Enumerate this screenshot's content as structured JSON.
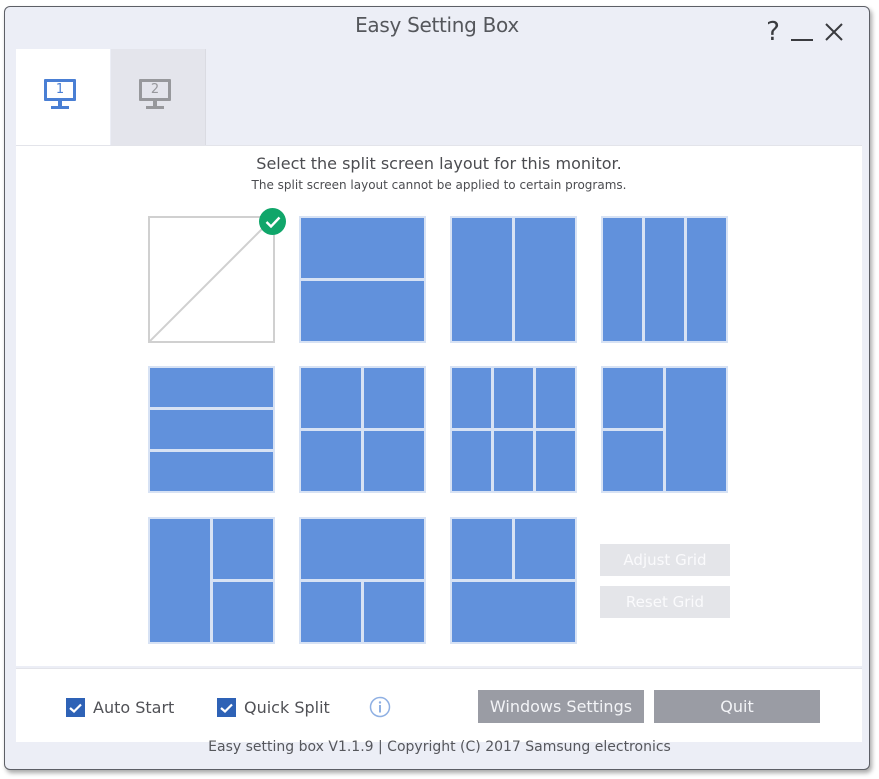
{
  "window": {
    "title": "Easy Setting Box",
    "controls": {
      "help": "?",
      "minimize": "minimize",
      "close": "close"
    }
  },
  "tabs": [
    {
      "label": "1",
      "icon": "monitor-icon",
      "selected": true
    },
    {
      "label": "2",
      "icon": "monitor-icon",
      "selected": false
    }
  ],
  "main": {
    "heading": "Select the split screen layout for this monitor.",
    "subheading": "The split screen layout cannot be applied to certain programs.",
    "selected_layout": "none",
    "layouts": [
      {
        "id": "none",
        "description": "No split"
      },
      {
        "id": "2-horizontal",
        "description": "Two rows"
      },
      {
        "id": "2-vertical",
        "description": "Two columns"
      },
      {
        "id": "3-vertical",
        "description": "Three columns"
      },
      {
        "id": "3-horizontal",
        "description": "Three rows"
      },
      {
        "id": "4-grid",
        "description": "2x2 grid"
      },
      {
        "id": "6-grid",
        "description": "3x2 grid"
      },
      {
        "id": "3-left-stack",
        "description": "Two stacked left, one tall right"
      },
      {
        "id": "3-right-stack",
        "description": "One tall left, two stacked right"
      },
      {
        "id": "3-top-wide",
        "description": "One wide top, two bottom"
      },
      {
        "id": "3-bottom-wide",
        "description": "Two top, one wide bottom"
      }
    ],
    "adjust_grid_label": "Adjust Grid",
    "reset_grid_label": "Reset Grid"
  },
  "bottom": {
    "auto_start": {
      "label": "Auto Start",
      "checked": true
    },
    "quick_split": {
      "label": "Quick Split",
      "checked": true
    },
    "windows_settings_label": "Windows Settings",
    "quit_label": "Quit"
  },
  "footer": "Easy setting box V1.1.9 | Copyright (C) 2017 Samsung electronics",
  "colors": {
    "accent_blue": "#6191dc",
    "selected_check": "#10a66a",
    "checkbox": "#2e62b6",
    "button_gray": "#9a9ca4"
  }
}
